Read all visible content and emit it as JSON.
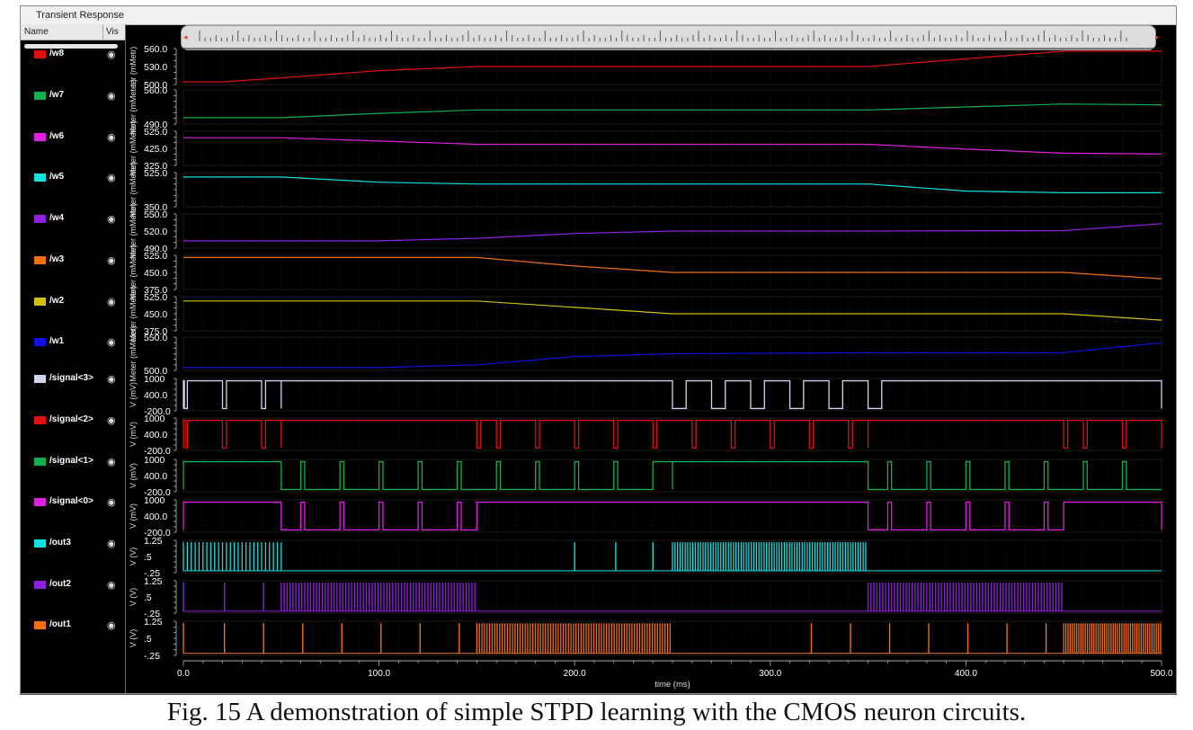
{
  "window": {
    "title": "Transient Response"
  },
  "trace_panel": {
    "header_name": "Name",
    "header_vis": "Vis",
    "traces": [
      {
        "label": "/w8",
        "color": "#e01010"
      },
      {
        "label": "/w7",
        "color": "#10b050"
      },
      {
        "label": "/w6",
        "color": "#e020e0"
      },
      {
        "label": "/w5",
        "color": "#10e0e0"
      },
      {
        "label": "/w4",
        "color": "#9020e0"
      },
      {
        "label": "/w3",
        "color": "#f07010"
      },
      {
        "label": "/w2",
        "color": "#d0c010"
      },
      {
        "label": "/w1",
        "color": "#1010e0"
      },
      {
        "label": "/signal<3>",
        "color": "#d0d8f0"
      },
      {
        "label": "/signal<2>",
        "color": "#e01010"
      },
      {
        "label": "/signal<1>",
        "color": "#10b050"
      },
      {
        "label": "/signal<0>",
        "color": "#e020e0"
      },
      {
        "label": "/out3",
        "color": "#10e0e0"
      },
      {
        "label": "/out2",
        "color": "#9020e0"
      },
      {
        "label": "/out1",
        "color": "#f07010"
      }
    ]
  },
  "caption": "Fig. 15 A demonstration of simple STPD learning with the CMOS neuron circuits.",
  "chart_data": {
    "type": "line",
    "xlabel": "time (ms)",
    "xlim": [
      0,
      500
    ],
    "xticks": [
      "0.0",
      "100.0",
      "200.0",
      "300.0",
      "400.0",
      "500.0"
    ],
    "strips": [
      {
        "name": "/w8",
        "ylabel": "ter (mMetr)",
        "ticks": [
          "560.0",
          "530.0",
          "500.0"
        ],
        "ylim": [
          495,
          565
        ],
        "x": [
          0,
          20,
          50,
          100,
          150,
          300,
          350,
          400,
          450,
          500
        ],
        "y": [
          500,
          500,
          508,
          522,
          530,
          530,
          530,
          545,
          560,
          560
        ]
      },
      {
        "name": "/w7",
        "ylabel": "Meter (mMeter)",
        "ticks": [
          "560.0",
          "490.0"
        ],
        "ylim": [
          485,
          565
        ],
        "x": [
          0,
          50,
          100,
          150,
          200,
          250,
          350,
          400,
          450,
          500
        ],
        "y": [
          500,
          500,
          510,
          518,
          518,
          518,
          518,
          525,
          532,
          530
        ]
      },
      {
        "name": "/w6",
        "ylabel": "Meter (mMeter)",
        "ticks": [
          "525.0",
          "425.0",
          "325.0"
        ],
        "ylim": [
          320,
          530
        ],
        "x": [
          0,
          50,
          100,
          150,
          200,
          350,
          400,
          450,
          500
        ],
        "y": [
          490,
          490,
          470,
          450,
          450,
          450,
          420,
          395,
          390
        ]
      },
      {
        "name": "/w5",
        "ylabel": "Meter (mMeter)",
        "ticks": [
          "525.0",
          "350.0"
        ],
        "ylim": [
          340,
          535
        ],
        "x": [
          0,
          50,
          100,
          150,
          200,
          350,
          400,
          450,
          500
        ],
        "y": [
          510,
          510,
          480,
          470,
          470,
          470,
          430,
          420,
          420
        ]
      },
      {
        "name": "/w4",
        "ylabel": "Meter (mMeter)",
        "ticks": [
          "550.0",
          "520.0",
          "490.0"
        ],
        "ylim": [
          485,
          555
        ],
        "x": [
          0,
          50,
          100,
          150,
          200,
          250,
          320,
          350,
          450,
          500
        ],
        "y": [
          500,
          500,
          500,
          505,
          515,
          520,
          520,
          520,
          521,
          535
        ]
      },
      {
        "name": "/w3",
        "ylabel": "Meter (mMeter)",
        "ticks": [
          "525.0",
          "450.0",
          "375.0"
        ],
        "ylim": [
          370,
          530
        ],
        "x": [
          0,
          50,
          100,
          150,
          200,
          250,
          350,
          450,
          500
        ],
        "y": [
          520,
          520,
          520,
          520,
          480,
          450,
          450,
          450,
          420
        ]
      },
      {
        "name": "/w2",
        "ylabel": "Meter (mMeter)",
        "ticks": [
          "525.0",
          "450.0",
          "375.0"
        ],
        "ylim": [
          370,
          530
        ],
        "x": [
          0,
          50,
          100,
          150,
          200,
          250,
          350,
          450,
          500
        ],
        "y": [
          510,
          510,
          510,
          510,
          480,
          450,
          450,
          450,
          420
        ]
      },
      {
        "name": "/w1",
        "ylabel": "Meter (mMeter)",
        "ticks": [
          "550.0",
          "500.0"
        ],
        "ylim": [
          495,
          555
        ],
        "x": [
          0,
          50,
          100,
          150,
          200,
          250,
          350,
          450,
          500
        ],
        "y": [
          500,
          500,
          500,
          505,
          520,
          525,
          527,
          527,
          545
        ]
      },
      {
        "name": "/signal<3>",
        "ylabel": "V (mV)",
        "ticks": [
          "1000",
          "400.0",
          "-200.0"
        ],
        "ylim": [
          -300,
          1100
        ],
        "high_intervals": [
          [
            0,
            0.5
          ],
          [
            2,
            20
          ],
          [
            22,
            40
          ],
          [
            42,
            50
          ],
          [
            50,
            250
          ],
          [
            257,
            270
          ],
          [
            277,
            290
          ],
          [
            297,
            310
          ],
          [
            317,
            330
          ],
          [
            337,
            350
          ],
          [
            357,
            500
          ]
        ]
      },
      {
        "name": "/signal<2>",
        "ylabel": "V (mV)",
        "ticks": [
          "1000",
          "400.0",
          "-200.0"
        ],
        "ylim": [
          -300,
          1100
        ],
        "high_intervals": [
          [
            0,
            1
          ],
          [
            2,
            20
          ],
          [
            22,
            40
          ],
          [
            42,
            50
          ],
          [
            50,
            150
          ],
          [
            152,
            160
          ],
          [
            162,
            180
          ],
          [
            182,
            200
          ],
          [
            202,
            220
          ],
          [
            222,
            240
          ],
          [
            242,
            260
          ],
          [
            262,
            280
          ],
          [
            282,
            300
          ],
          [
            302,
            320
          ],
          [
            322,
            340
          ],
          [
            342,
            350
          ],
          [
            350,
            450
          ],
          [
            452,
            460
          ],
          [
            462,
            480
          ],
          [
            482,
            500
          ]
        ]
      },
      {
        "name": "/signal<1>",
        "ylabel": "V (mV)",
        "ticks": [
          "1000",
          "400.0",
          "-200.0"
        ],
        "ylim": [
          -300,
          1100
        ],
        "high_intervals": [
          [
            0,
            50
          ],
          [
            60,
            62
          ],
          [
            80,
            82
          ],
          [
            100,
            102
          ],
          [
            120,
            122
          ],
          [
            140,
            142
          ],
          [
            160,
            162
          ],
          [
            180,
            182
          ],
          [
            200,
            202
          ],
          [
            220,
            222
          ],
          [
            240,
            250
          ],
          [
            250,
            350
          ],
          [
            360,
            362
          ],
          [
            380,
            382
          ],
          [
            400,
            402
          ],
          [
            420,
            422
          ],
          [
            440,
            442
          ],
          [
            460,
            462
          ],
          [
            480,
            482
          ]
        ]
      },
      {
        "name": "/signal<0>",
        "ylabel": "V (mV)",
        "ticks": [
          "1000",
          "400.0",
          "-200.0"
        ],
        "ylim": [
          -300,
          1100
        ],
        "high_intervals": [
          [
            0,
            50
          ],
          [
            60,
            62
          ],
          [
            80,
            82
          ],
          [
            100,
            102
          ],
          [
            120,
            122
          ],
          [
            140,
            142
          ],
          [
            150,
            350
          ],
          [
            360,
            362
          ],
          [
            380,
            382
          ],
          [
            400,
            402
          ],
          [
            420,
            422
          ],
          [
            440,
            442
          ],
          [
            450,
            500
          ]
        ]
      },
      {
        "name": "/out3",
        "ylabel": "V (V)",
        "ticks": [
          "1.25",
          ".5",
          "-.25"
        ],
        "ylim": [
          -0.35,
          1.35
        ],
        "spike_bursts": [
          [
            0,
            50,
            2
          ],
          [
            200,
            200,
            2
          ],
          [
            221,
            221,
            2
          ],
          [
            240,
            240,
            2
          ],
          [
            250,
            350,
            1.3
          ]
        ]
      },
      {
        "name": "/out2",
        "ylabel": "V (V)",
        "ticks": [
          "1.25",
          ".5",
          "-.25"
        ],
        "ylim": [
          -0.35,
          1.35
        ],
        "spike_bursts": [
          [
            0,
            0,
            2
          ],
          [
            21,
            21,
            2
          ],
          [
            41,
            41,
            2
          ],
          [
            50,
            150,
            1.5
          ],
          [
            350,
            450,
            1.5
          ]
        ]
      },
      {
        "name": "/out1",
        "ylabel": "V (V)",
        "ticks": [
          "1.25",
          ".5",
          "-.25"
        ],
        "ylim": [
          -0.35,
          1.35
        ],
        "spike_bursts": [
          [
            0,
            0,
            2
          ],
          [
            21,
            21,
            2
          ],
          [
            41,
            41,
            2
          ],
          [
            61,
            61,
            2
          ],
          [
            81,
            81,
            2
          ],
          [
            101,
            101,
            2
          ],
          [
            121,
            121,
            2
          ],
          [
            141,
            141,
            2
          ],
          [
            150,
            250,
            1.3
          ],
          [
            321,
            321,
            2
          ],
          [
            341,
            341,
            2
          ],
          [
            361,
            361,
            2
          ],
          [
            381,
            381,
            2
          ],
          [
            401,
            401,
            2
          ],
          [
            421,
            421,
            2
          ],
          [
            441,
            441,
            2
          ],
          [
            450,
            500,
            1.1
          ]
        ]
      }
    ]
  }
}
